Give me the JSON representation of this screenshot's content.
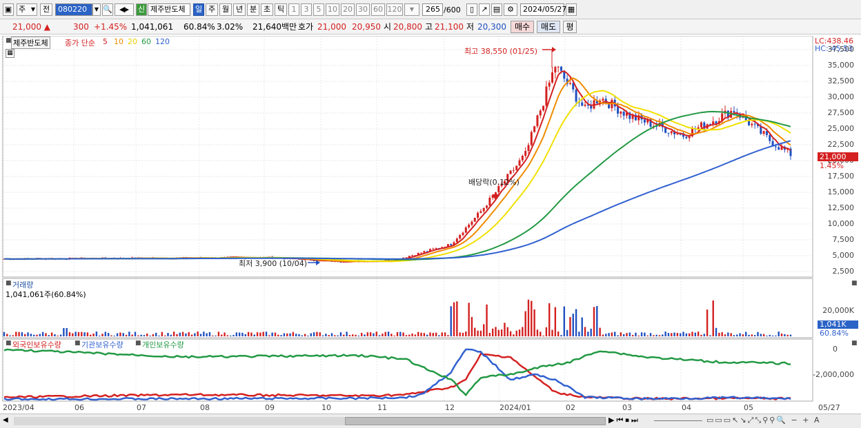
{
  "toolbar": {
    "market": "주",
    "prev": "전",
    "code": "080220",
    "badge": "신",
    "name": "제주반도체",
    "periods": [
      "일",
      "주",
      "월",
      "년",
      "분",
      "초",
      "틱"
    ],
    "minutes": [
      "1",
      "3",
      "5",
      "10",
      "20",
      "30",
      "60",
      "120"
    ],
    "count": "265",
    "count_max": "/600",
    "date": "2024/05/27"
  },
  "quote": {
    "price": "21,000 ▲",
    "change": "300",
    "rate": "+1.45%",
    "volume": "1,041,061",
    "vol_ratio": "60.84%",
    "turnover": "3.02%",
    "amount": "21,640백만",
    "bid_label": "호가",
    "ask": "21,000",
    "bid": "20,950",
    "open_label": "시",
    "open": "20,800",
    "high_label": "고",
    "high": "21,100",
    "low_label": "저",
    "low": "20,300",
    "buy": "매수",
    "sell": "매도",
    "flat": "평"
  },
  "price_panel": {
    "name": "제주반도체",
    "ma_label": "종가 단순",
    "ma_periods": [
      "5",
      "10",
      "20",
      "60",
      "120"
    ],
    "ma_colors": [
      "#d42020",
      "#f08c00",
      "#f0e000",
      "#229944",
      "#3060d0"
    ],
    "lc": "LC:438.46",
    "hc": "HC:-45.53",
    "y_ticks": [
      "37,500",
      "35,000",
      "32,500",
      "30,000",
      "27,500",
      "25,000",
      "22,500",
      "20,000",
      "17,500",
      "15,000",
      "12,500",
      "10,000",
      "7,500",
      "5,000",
      "2,500"
    ],
    "last_price_tag": "21,000",
    "last_rate_tag": "1.45%",
    "high_annot": "최고 38,550 (01/25)",
    "low_annot": "최저 3,900 (10/04)",
    "div_annot": "배당락(0.12%)"
  },
  "volume_panel": {
    "title": "거래량",
    "value": "1,041,061주(60.84%)",
    "y_tick": "20,000K",
    "tag": "1,041K",
    "tag2": "60.84%"
  },
  "holdings_panel": {
    "legend": [
      "외국인보유수량",
      "기관보유수량",
      "개인보유수량"
    ],
    "colors": [
      "#d42020",
      "#3060d0",
      "#229944"
    ],
    "y_ticks": [
      "0",
      "-2,000,000"
    ]
  },
  "x_axis": [
    "2023/04",
    "06",
    "07",
    "08",
    "09",
    "10",
    "11",
    "12",
    "2024/01",
    "02",
    "03",
    "04",
    "05",
    "05/27"
  ]
}
